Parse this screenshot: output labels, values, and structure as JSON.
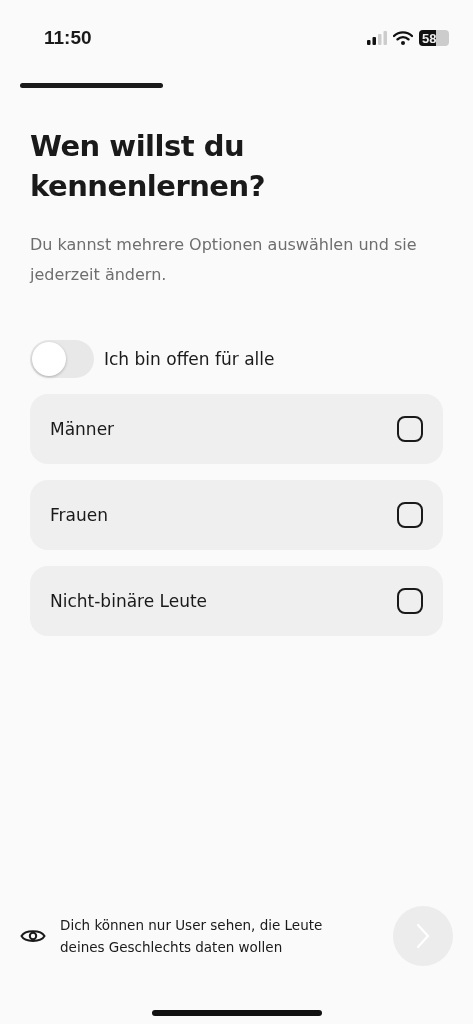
{
  "status_bar": {
    "time": "11:50",
    "battery": "58"
  },
  "title": "Wen willst du kennenlernen?",
  "subtitle": "Du kannst mehrere Optionen auswählen und sie jederzeit ändern.",
  "open_toggle": {
    "label": "Ich bin offen für alle",
    "on": false
  },
  "options": [
    {
      "label": "Männer",
      "checked": false
    },
    {
      "label": "Frauen",
      "checked": false
    },
    {
      "label": "Nicht-binäre Leute",
      "checked": false
    }
  ],
  "footer": {
    "note": "Dich können nur User sehen, die Leute deines Geschlechts daten wollen",
    "next_disabled": true
  }
}
